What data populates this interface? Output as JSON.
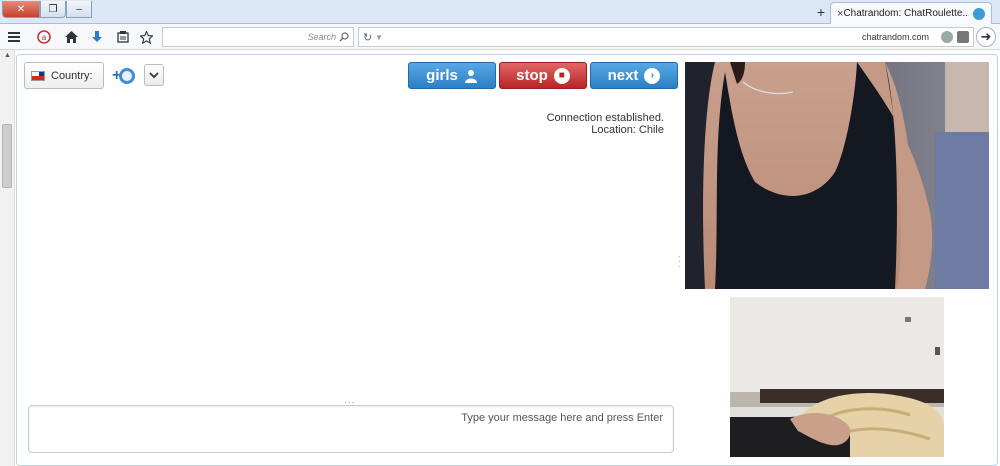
{
  "browser": {
    "tab_title": "Chatrandom: ChatRoulette...",
    "tab_close": "×",
    "new_tab": "+",
    "search_placeholder": "Search",
    "url": "chatrandom.com",
    "window_controls": {
      "close": "✕",
      "maximize": "❐",
      "minimize": "–"
    },
    "icons": [
      "menu-icon",
      "adblock-icon",
      "home-icon",
      "download-icon",
      "reading-list-icon",
      "bookmark-star-icon",
      "search-icon",
      "reload-icon",
      "dropdown-icon",
      "page-icon",
      "globe-icon",
      "back-icon"
    ]
  },
  "chat": {
    "country_label": "Country:",
    "country_flag": "Chile",
    "buttons": {
      "girls": "girls",
      "stop": "stop",
      "next": "next"
    },
    "status_lines": [
      "Connection established.",
      "Location: Chile"
    ],
    "input_placeholder": "Type your message here and press Enter",
    "resize_dots": "...",
    "colors": {
      "blue_button": "#2c7fc4",
      "red_button": "#b72626"
    }
  }
}
